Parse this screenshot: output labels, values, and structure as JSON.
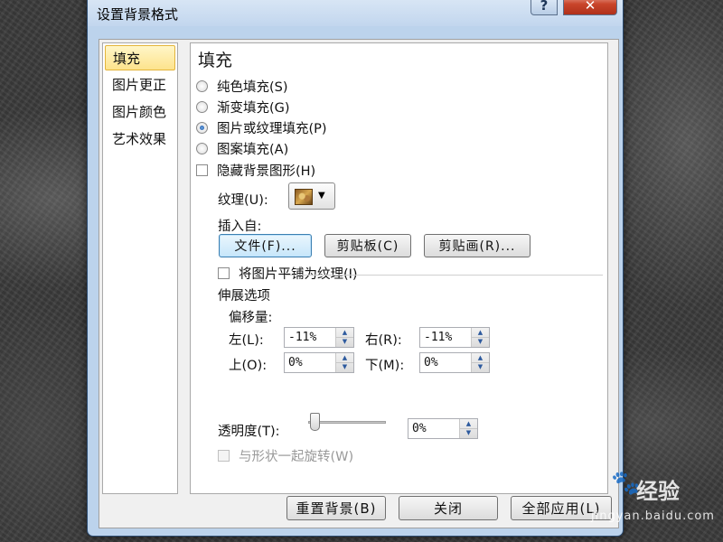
{
  "dialog": {
    "title": "设置背景格式",
    "help_label": "?",
    "close_label": "✕"
  },
  "nav": {
    "items": [
      {
        "label": "填充",
        "selected": true
      },
      {
        "label": "图片更正",
        "selected": false
      },
      {
        "label": "图片颜色",
        "selected": false
      },
      {
        "label": "艺术效果",
        "selected": false
      }
    ]
  },
  "fill": {
    "section_title": "填充",
    "options": [
      {
        "label": "纯色填充(S)",
        "checked": false
      },
      {
        "label": "渐变填充(G)",
        "checked": false
      },
      {
        "label": "图片或纹理填充(P)",
        "checked": true
      },
      {
        "label": "图案填充(A)",
        "checked": false
      }
    ],
    "hide_background_graphics": "隐藏背景图形(H)",
    "texture_label": "纹理(U):",
    "insert_from_label": "插入自:",
    "file_button": "文件(F)...",
    "clipboard_button": "剪贴板(C)",
    "clipart_button": "剪贴画(R)...",
    "tile_as_texture": "将图片平铺为纹理(I)",
    "stretch_options_label": "伸展选项",
    "offset_label": "偏移量:",
    "left_label": "左(L):",
    "left_value": "-11%",
    "right_label": "右(R):",
    "right_value": "-11%",
    "top_label": "上(O):",
    "top_value": "0%",
    "bottom_label": "下(M):",
    "bottom_value": "0%",
    "transparency_label": "透明度(T):",
    "transparency_value": "0%",
    "rotate_with_shape": "与形状一起旋转(W)"
  },
  "footer": {
    "reset_button": "重置背景(B)",
    "close_button": "关闭",
    "apply_all_button": "全部应用(L)"
  },
  "watermark": {
    "brand": "Bai",
    "paw": "🐾",
    "jingyan": "经验",
    "url": "jingyan.baidu.com"
  }
}
